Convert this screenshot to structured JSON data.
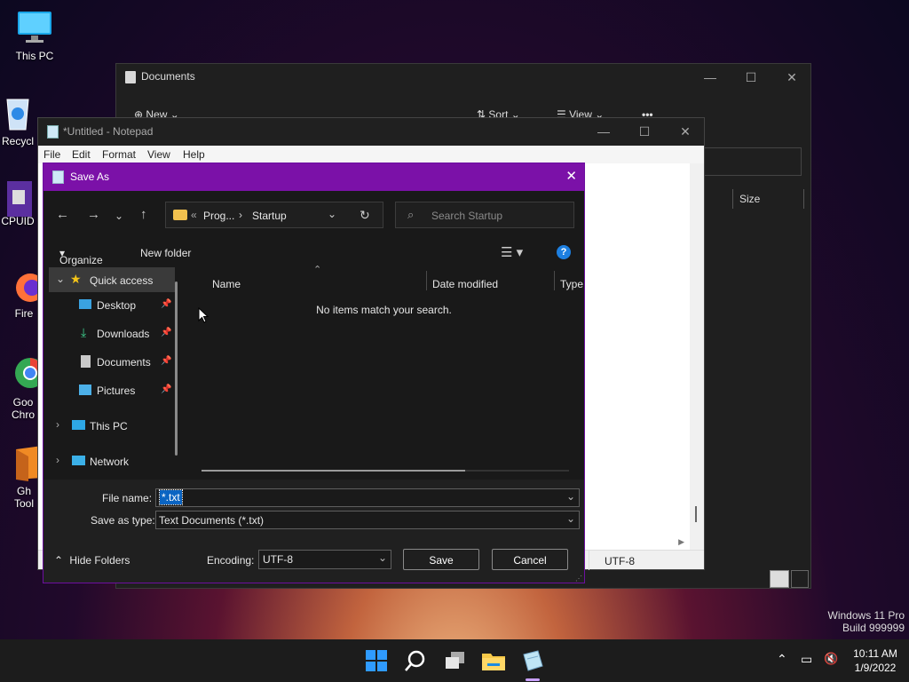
{
  "desktop": {
    "icons": [
      {
        "label": "This PC"
      },
      {
        "label": "Recycl"
      },
      {
        "label": "CPUID"
      },
      {
        "label": "Fire"
      },
      {
        "label": "Goo\nChro"
      },
      {
        "label": "Gh\nTool"
      }
    ],
    "watermark_line1": "Windows 11 Pro",
    "watermark_line2": "Build 999999"
  },
  "explorer": {
    "title": "Documents",
    "toolbar": {
      "new": "New",
      "sort": "Sort",
      "view": "View",
      "more": "•••"
    },
    "column_size": "Size"
  },
  "notepad": {
    "title": "*Untitled - Notepad",
    "menu": [
      "File",
      "Edit",
      "Format",
      "View",
      "Help"
    ],
    "status_encoding": "UTF-8"
  },
  "dialog": {
    "title": "Save As",
    "breadcrumb": {
      "overflow": "«",
      "parent": "Prog...",
      "separator": "›",
      "current": "Startup"
    },
    "search_placeholder": "Search Startup",
    "organize": "Organize",
    "new_folder": "New folder",
    "tree": {
      "quick_access": "Quick access",
      "desktop": "Desktop",
      "downloads": "Downloads",
      "documents": "Documents",
      "pictures": "Pictures",
      "this_pc": "This PC",
      "network": "Network"
    },
    "columns": {
      "name": "Name",
      "date_modified": "Date modified",
      "type": "Type"
    },
    "empty_message": "No items match your search.",
    "file_name_label": "File name:",
    "file_name_value": "*.txt",
    "save_type_label": "Save as type:",
    "save_type_value": "Text Documents (*.txt)",
    "hide_folders": "Hide Folders",
    "encoding_label": "Encoding:",
    "encoding_value": "UTF-8",
    "save_button": "Save",
    "cancel_button": "Cancel"
  },
  "taskbar": {
    "time": "10:11 AM",
    "date": "1/9/2022"
  },
  "colors": {
    "dialog_title_bar": "#7b11a8",
    "accent_blue": "#0078d4",
    "selection_blue": "#0a64c2"
  }
}
